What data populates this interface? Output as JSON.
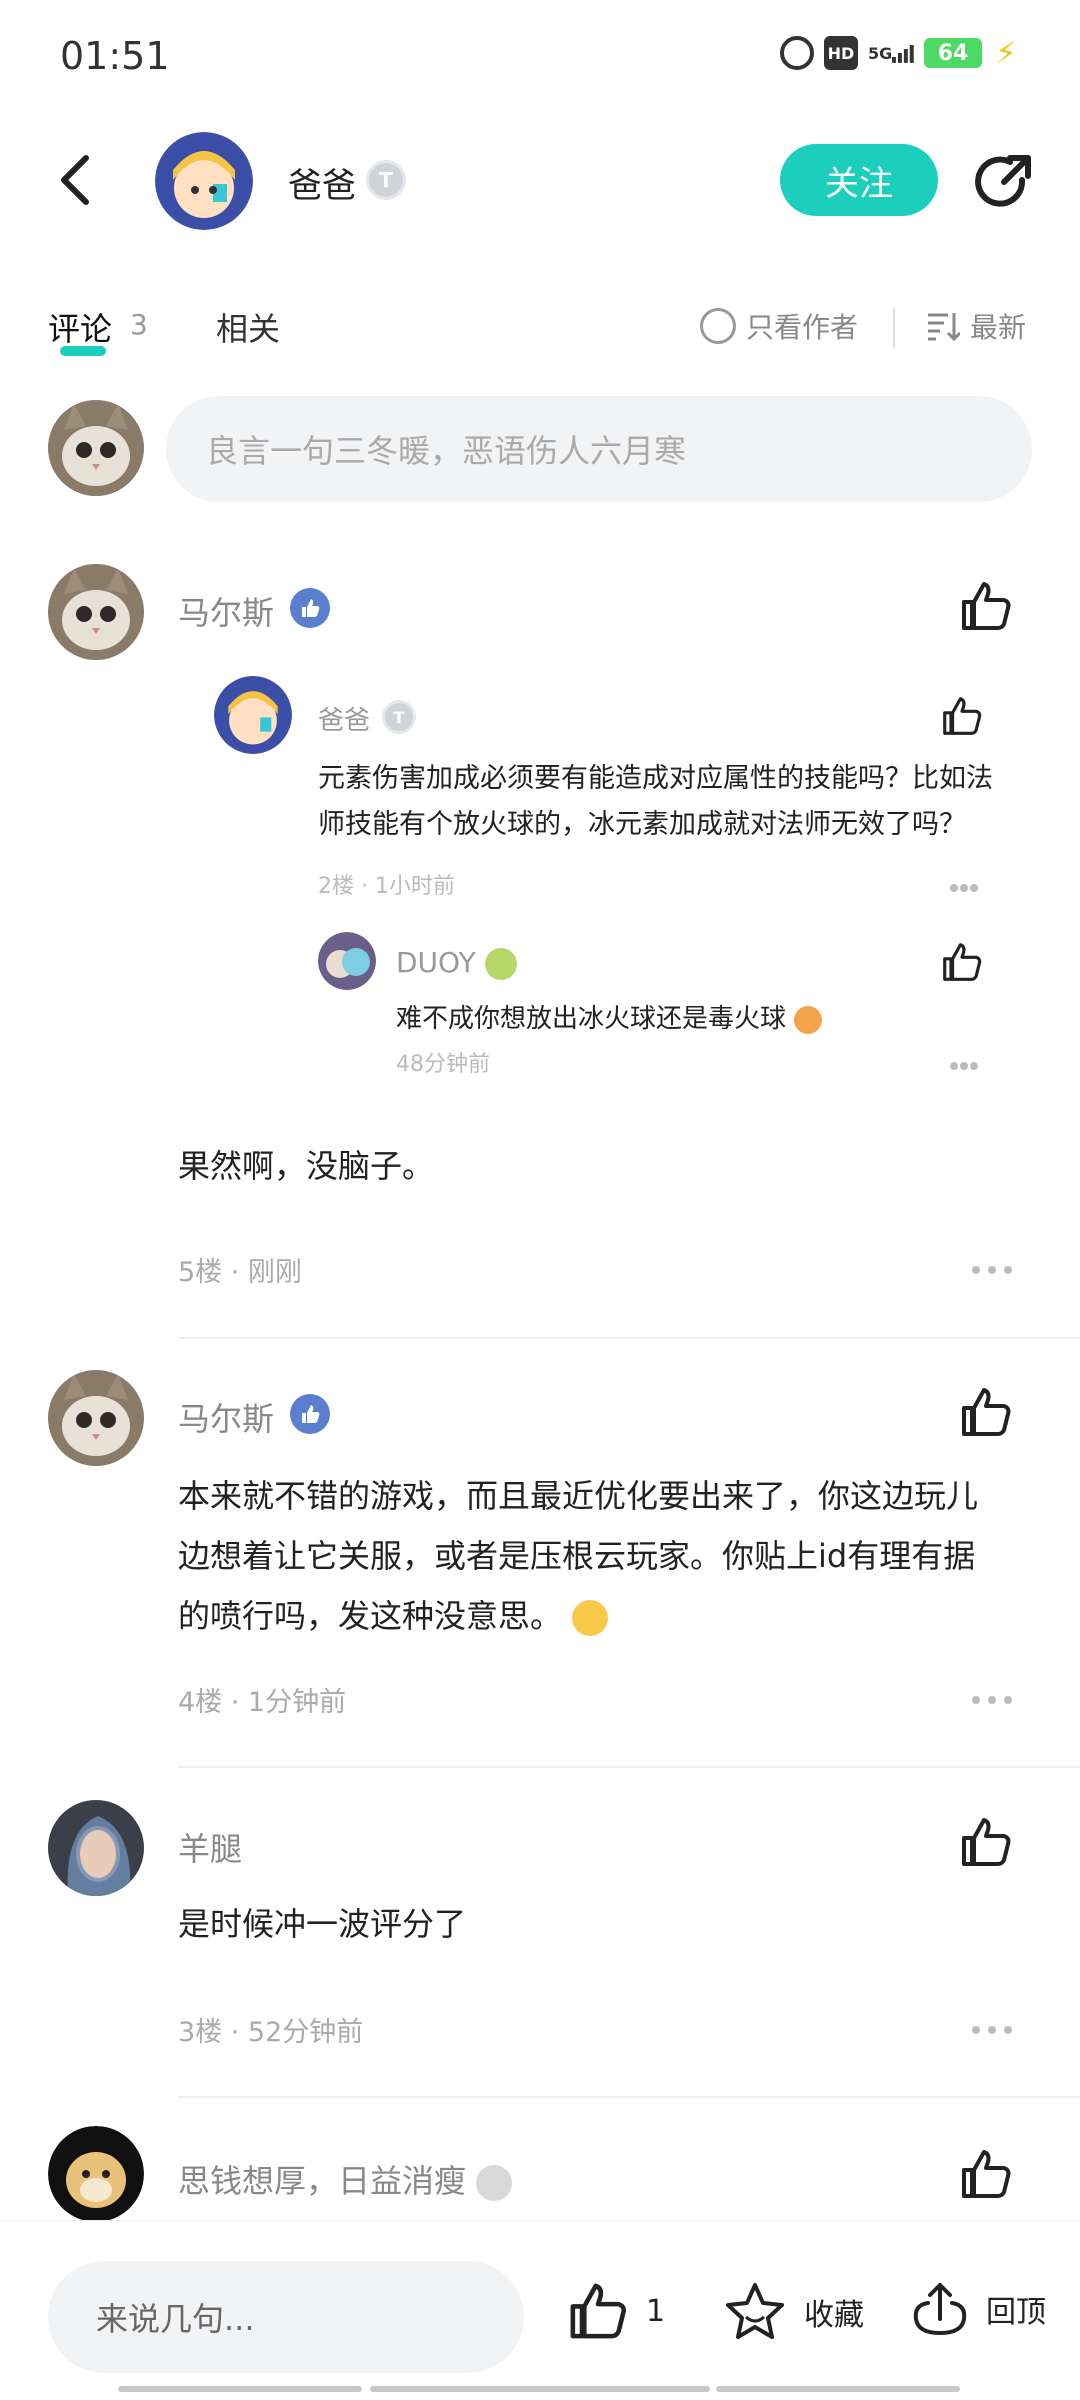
{
  "status_bar": {
    "time": "01:51",
    "signal_label": "5G",
    "hd_label": "HD",
    "battery": "64"
  },
  "header": {
    "author_name": "爸爸",
    "level_badge": "T",
    "follow_label": "关注"
  },
  "tabs": {
    "comments_label": "评论",
    "comments_count": "3",
    "related_label": "相关",
    "only_author_label": "只看作者",
    "sort_label": "最新"
  },
  "composer": {
    "placeholder": "良言一句三冬暖，恶语伤人六月寒"
  },
  "comments": [
    {
      "name": "马尔斯",
      "text": "果然啊，没脑子。",
      "meta": "5楼 · 刚刚",
      "quoted": {
        "name": "爸爸",
        "badge": "T",
        "text": "元素伤害加成必须要有能造成对应属性的技能吗？比如法师技能有个放火球的，冰元素加成就对法师无效了吗？",
        "meta": "2楼 · 1小时前",
        "reply": {
          "name": "DUOY",
          "text": "难不成你想放出冰火球还是毒火球",
          "meta": "48分钟前"
        }
      }
    },
    {
      "name": "马尔斯",
      "text_lines": [
        "本来就不错的游戏，而且最近优化要出来了，你这边玩儿",
        "边想着让它关服，或者是压根云玩家。你贴上id有理有据",
        "的喷行吗，发这种没意思。"
      ],
      "meta": "4楼 · 1分钟前"
    },
    {
      "name": "羊腿",
      "text": "是时候冲一波评分了",
      "meta": "3楼 · 52分钟前"
    },
    {
      "name": "思钱想厚，日益消瘦"
    }
  ],
  "bottom_bar": {
    "input_placeholder": "来说几句...",
    "like_count": "1",
    "favorite_label": "收藏",
    "top_label": "回顶"
  },
  "colors": {
    "accent": "#1ccfbd",
    "muted_text": "#888888",
    "badge_blue": "#5b7fcf"
  }
}
